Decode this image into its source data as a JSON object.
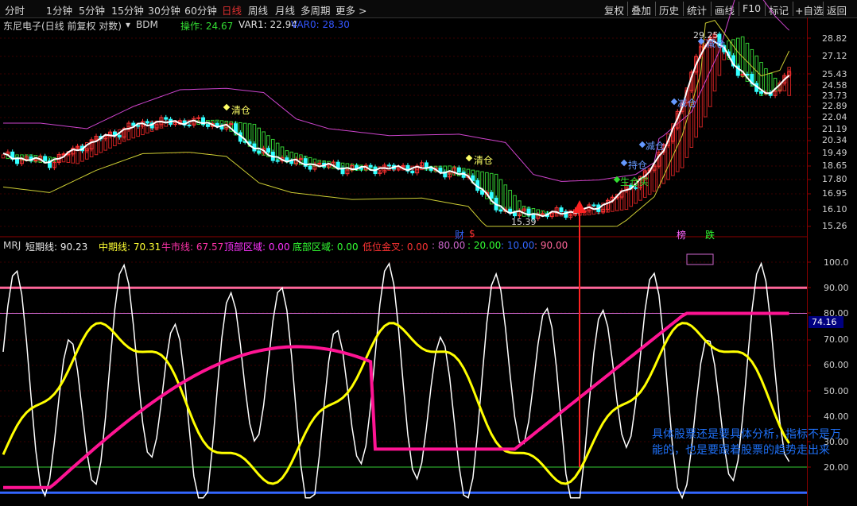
{
  "toolbar": {
    "timeframes": [
      "分时",
      "1分钟",
      "5分钟",
      "15分钟",
      "30分钟",
      "60分钟",
      "日线",
      "周线",
      "月线",
      "多周期",
      "更多 >"
    ],
    "active_timeframe": "日线",
    "actions": [
      "复权",
      "叠加",
      "历史",
      "统计",
      "画线",
      "F10",
      "标记",
      "+自选",
      "返回"
    ]
  },
  "main_chart": {
    "title": "东尼电子(日线 前复权 对数)",
    "indicator": "BDM",
    "caozuo_label": "操作: 24.67",
    "var1_label": "VAR1: 22.94",
    "var0_label": "VAR0: 28.30",
    "price_ticks": [
      "28.82",
      "27.12",
      "25.43",
      "24.58",
      "23.73",
      "22.89",
      "22.04",
      "21.19",
      "20.34",
      "19.49",
      "18.65",
      "17.80",
      "16.95",
      "16.10",
      "15.26"
    ],
    "annotations": {
      "high": "29.25",
      "low": "15.39",
      "qingcang1": "清仓",
      "qingcang2": "清仓",
      "jian1": "减仓",
      "jian2": "减仓",
      "jian3": "减仓",
      "jiancang_top": "减仓",
      "chicang": "持仓",
      "shengcang": "生仓买",
      "cai": "财",
      "san": "$",
      "bang": "榜",
      "die": "跌"
    }
  },
  "sub_chart": {
    "indicator": "MRJ",
    "short_label": "短期线: 90.23",
    "mid_label": "中期线: 70.31",
    "bull_label": "牛市线: 67.57",
    "top_label": "顶部区域: 0.00",
    "bottom_label": "底部区域: 0.00",
    "cross_label": "低位金叉: 0.00",
    "levels_label": [
      ": 80.00",
      ": 20.00",
      ": 10.00",
      ": 90.00"
    ],
    "ticks": [
      "100.0",
      "90.00",
      "80.00",
      "70.00",
      "60.00",
      "50.00",
      "40.00",
      "30.00",
      "20.00"
    ],
    "current_value": "74.16"
  },
  "note_text": "具体股票还是要具体分析，指标不是万能的，也是要跟着股票的趋势走出来",
  "colors": {
    "up": "#ff3333",
    "down": "#33ffff",
    "white_line": "#ffffff",
    "yellow_line": "#ffff00",
    "magenta_line": "#ff1493",
    "band_green": "#33cc33",
    "band_red": "#cc2222",
    "purple_line": "#b040d0",
    "upper_band": "#cc44cc",
    "lower_band": "#cccc33"
  }
}
